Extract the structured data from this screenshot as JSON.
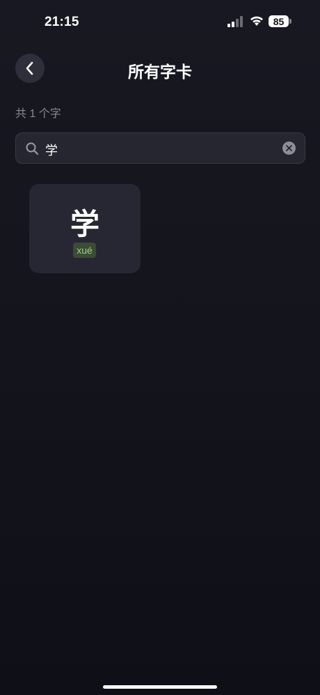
{
  "status_bar": {
    "time": "21:15",
    "battery": "85",
    "signal_icon": "cellular-signal-icon",
    "wifi_icon": "wifi-icon"
  },
  "header": {
    "title": "所有字卡",
    "back_icon": "chevron-left-icon"
  },
  "count_label": "共 1 个字",
  "search": {
    "value": "学",
    "search_icon": "search-icon",
    "clear_icon": "clear-circle-icon"
  },
  "cards": [
    {
      "character": "学",
      "pinyin": "xué"
    }
  ],
  "colors": {
    "background": "#15151e",
    "card": "#272733",
    "pinyin_text": "#9ad47a",
    "pinyin_badge": "#3a4b36",
    "secondary_text": "#8a8a97"
  }
}
